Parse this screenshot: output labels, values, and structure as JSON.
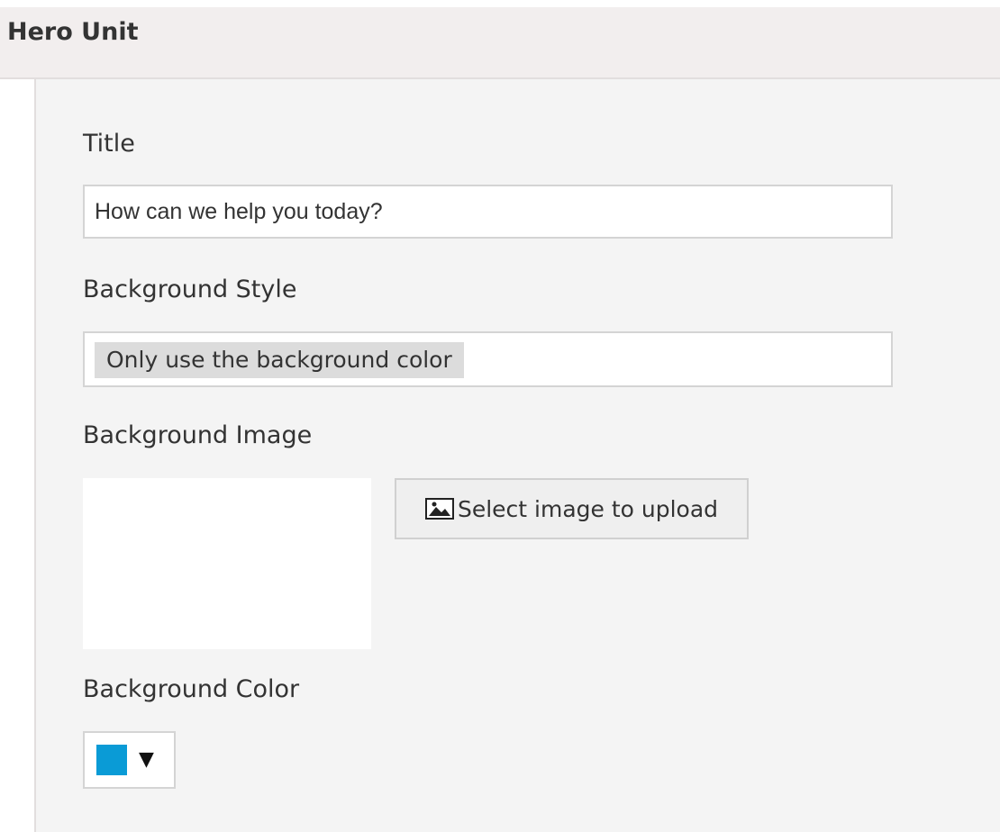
{
  "section": {
    "title": "Hero Unit"
  },
  "fields": {
    "title": {
      "label": "Title",
      "value": "How can we help you today?"
    },
    "background_style": {
      "label": "Background Style",
      "selected": "Only use the background color"
    },
    "background_image": {
      "label": "Background Image",
      "button_label": "Select image to upload",
      "button_icon": "image-icon"
    },
    "background_color": {
      "label": "Background Color",
      "value": "#0a9bd6",
      "arrow": "▼"
    }
  }
}
